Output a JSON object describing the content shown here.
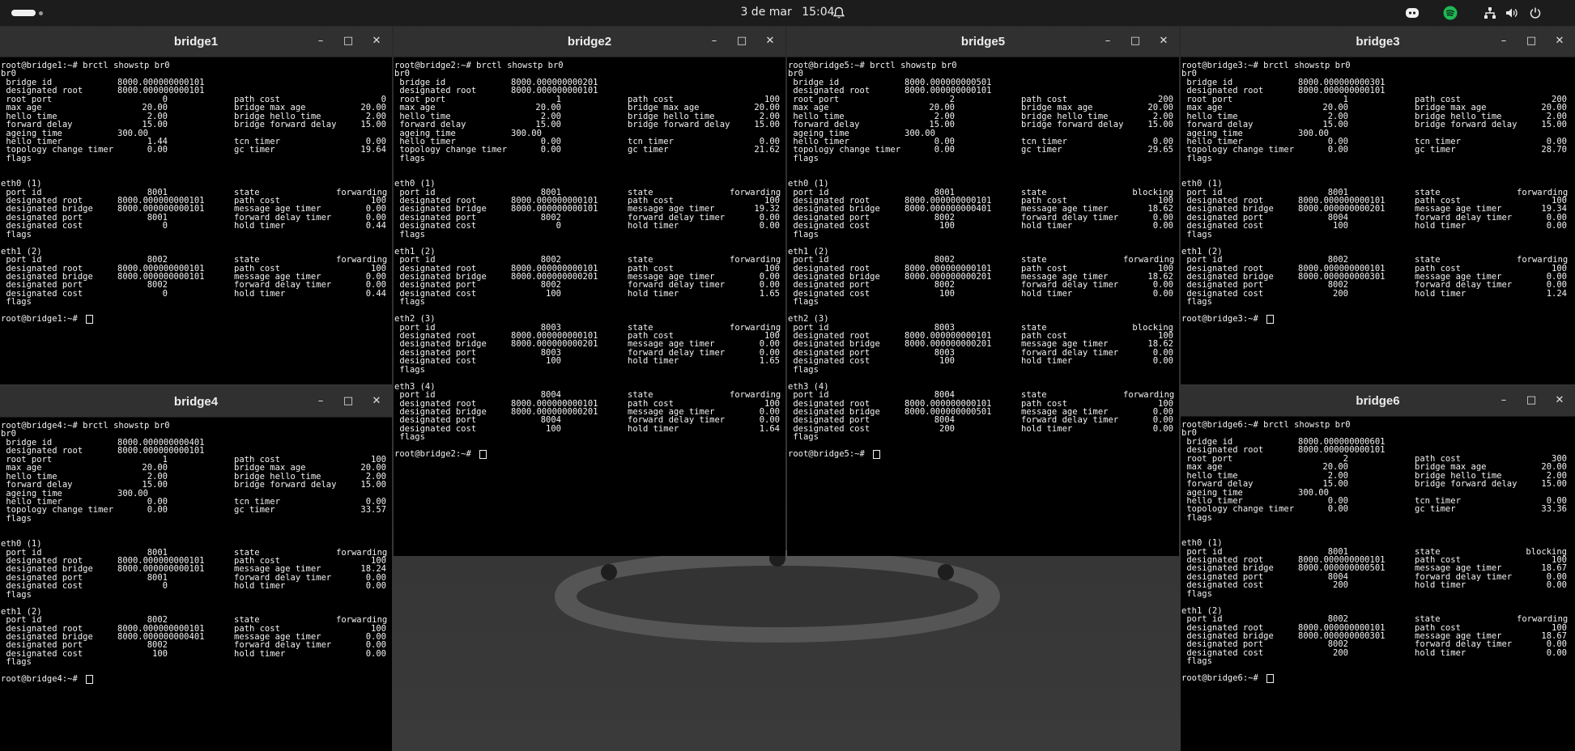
{
  "topbar": {
    "date": "3 de mar",
    "time": "15:04",
    "icons": [
      "activities-icon",
      "notification-bell-icon",
      "discord-icon",
      "spotify-icon",
      "network-icon",
      "volume-icon",
      "power-icon"
    ]
  },
  "windows": [
    {
      "id": "bridge1",
      "title": "bridge1",
      "lines": [
        [
          "root@bridge1:~# brctl showstp br0"
        ],
        [
          "br0"
        ],
        [
          " bridge id",
          "8000.000000000101"
        ],
        [
          " designated root",
          "8000.000000000101"
        ],
        [
          " root port",
          "0",
          "path cost",
          "0"
        ],
        [
          " max age",
          "20.00",
          "bridge max age",
          "20.00"
        ],
        [
          " hello time",
          "2.00",
          "bridge hello time",
          "2.00"
        ],
        [
          " forward delay",
          "15.00",
          "bridge forward delay",
          "15.00"
        ],
        [
          " ageing time",
          "300.00"
        ],
        [
          " hello timer",
          "1.44",
          "tcn timer",
          "0.00"
        ],
        [
          " topology change timer",
          "0.00",
          "gc timer",
          "19.64"
        ],
        [
          " flags"
        ],
        [
          ""
        ],
        [
          ""
        ],
        [
          "eth0 (1)"
        ],
        [
          " port id",
          "8001",
          "state",
          "forwarding"
        ],
        [
          " designated root",
          "8000.000000000101",
          "path cost",
          "100"
        ],
        [
          " designated bridge",
          "8000.000000000101",
          "message age timer",
          "0.00"
        ],
        [
          " designated port",
          "8001",
          "forward delay timer",
          "0.00"
        ],
        [
          " designated cost",
          "0",
          "hold timer",
          "0.44"
        ],
        [
          " flags"
        ],
        [
          ""
        ],
        [
          "eth1 (2)"
        ],
        [
          " port id",
          "8002",
          "state",
          "forwarding"
        ],
        [
          " designated root",
          "8000.000000000101",
          "path cost",
          "100"
        ],
        [
          " designated bridge",
          "8000.000000000101",
          "message age timer",
          "0.00"
        ],
        [
          " designated port",
          "8002",
          "forward delay timer",
          "0.00"
        ],
        [
          " designated cost",
          "0",
          "hold timer",
          "0.44"
        ],
        [
          " flags"
        ],
        [
          ""
        ],
        [
          "root@bridge1:~# "
        ]
      ]
    },
    {
      "id": "bridge2",
      "title": "bridge2",
      "lines": [
        [
          "root@bridge2:~# brctl showstp br0"
        ],
        [
          "br0"
        ],
        [
          " bridge id",
          "8000.000000000201"
        ],
        [
          " designated root",
          "8000.000000000101"
        ],
        [
          " root port",
          "1",
          "path cost",
          "100"
        ],
        [
          " max age",
          "20.00",
          "bridge max age",
          "20.00"
        ],
        [
          " hello time",
          "2.00",
          "bridge hello time",
          "2.00"
        ],
        [
          " forward delay",
          "15.00",
          "bridge forward delay",
          "15.00"
        ],
        [
          " ageing time",
          "300.00"
        ],
        [
          " hello timer",
          "0.00",
          "tcn timer",
          "0.00"
        ],
        [
          " topology change timer",
          "0.00",
          "gc timer",
          "21.62"
        ],
        [
          " flags"
        ],
        [
          ""
        ],
        [
          ""
        ],
        [
          "eth0 (1)"
        ],
        [
          " port id",
          "8001",
          "state",
          "forwarding"
        ],
        [
          " designated root",
          "8000.000000000101",
          "path cost",
          "100"
        ],
        [
          " designated bridge",
          "8000.000000000101",
          "message age timer",
          "19.32"
        ],
        [
          " designated port",
          "8002",
          "forward delay timer",
          "0.00"
        ],
        [
          " designated cost",
          "0",
          "hold timer",
          "0.00"
        ],
        [
          " flags"
        ],
        [
          ""
        ],
        [
          "eth1 (2)"
        ],
        [
          " port id",
          "8002",
          "state",
          "forwarding"
        ],
        [
          " designated root",
          "8000.000000000101",
          "path cost",
          "100"
        ],
        [
          " designated bridge",
          "8000.000000000201",
          "message age timer",
          "0.00"
        ],
        [
          " designated port",
          "8002",
          "forward delay timer",
          "0.00"
        ],
        [
          " designated cost",
          "100",
          "hold timer",
          "1.65"
        ],
        [
          " flags"
        ],
        [
          ""
        ],
        [
          "eth2 (3)"
        ],
        [
          " port id",
          "8003",
          "state",
          "forwarding"
        ],
        [
          " designated root",
          "8000.000000000101",
          "path cost",
          "100"
        ],
        [
          " designated bridge",
          "8000.000000000201",
          "message age timer",
          "0.00"
        ],
        [
          " designated port",
          "8003",
          "forward delay timer",
          "0.00"
        ],
        [
          " designated cost",
          "100",
          "hold timer",
          "1.65"
        ],
        [
          " flags"
        ],
        [
          ""
        ],
        [
          "eth3 (4)"
        ],
        [
          " port id",
          "8004",
          "state",
          "forwarding"
        ],
        [
          " designated root",
          "8000.000000000101",
          "path cost",
          "100"
        ],
        [
          " designated bridge",
          "8000.000000000201",
          "message age timer",
          "0.00"
        ],
        [
          " designated port",
          "8004",
          "forward delay timer",
          "0.00"
        ],
        [
          " designated cost",
          "100",
          "hold timer",
          "1.64"
        ],
        [
          " flags"
        ],
        [
          ""
        ],
        [
          "root@bridge2:~# "
        ]
      ]
    },
    {
      "id": "bridge5",
      "title": "bridge5",
      "lines": [
        [
          "root@bridge5:~# brctl showstp br0"
        ],
        [
          "br0"
        ],
        [
          " bridge id",
          "8000.000000000501"
        ],
        [
          " designated root",
          "8000.000000000101"
        ],
        [
          " root port",
          "2",
          "path cost",
          "200"
        ],
        [
          " max age",
          "20.00",
          "bridge max age",
          "20.00"
        ],
        [
          " hello time",
          "2.00",
          "bridge hello time",
          "2.00"
        ],
        [
          " forward delay",
          "15.00",
          "bridge forward delay",
          "15.00"
        ],
        [
          " ageing time",
          "300.00"
        ],
        [
          " hello timer",
          "0.00",
          "tcn timer",
          "0.00"
        ],
        [
          " topology change timer",
          "0.00",
          "gc timer",
          "29.65"
        ],
        [
          " flags"
        ],
        [
          ""
        ],
        [
          ""
        ],
        [
          "eth0 (1)"
        ],
        [
          " port id",
          "8001",
          "state",
          "blocking"
        ],
        [
          " designated root",
          "8000.000000000101",
          "path cost",
          "100"
        ],
        [
          " designated bridge",
          "8000.000000000401",
          "message age timer",
          "18.62"
        ],
        [
          " designated port",
          "8002",
          "forward delay timer",
          "0.00"
        ],
        [
          " designated cost",
          "100",
          "hold timer",
          "0.00"
        ],
        [
          " flags"
        ],
        [
          ""
        ],
        [
          "eth1 (2)"
        ],
        [
          " port id",
          "8002",
          "state",
          "forwarding"
        ],
        [
          " designated root",
          "8000.000000000101",
          "path cost",
          "100"
        ],
        [
          " designated bridge",
          "8000.000000000201",
          "message age timer",
          "18.62"
        ],
        [
          " designated port",
          "8002",
          "forward delay timer",
          "0.00"
        ],
        [
          " designated cost",
          "100",
          "hold timer",
          "0.00"
        ],
        [
          " flags"
        ],
        [
          ""
        ],
        [
          "eth2 (3)"
        ],
        [
          " port id",
          "8003",
          "state",
          "blocking"
        ],
        [
          " designated root",
          "8000.000000000101",
          "path cost",
          "100"
        ],
        [
          " designated bridge",
          "8000.000000000201",
          "message age timer",
          "18.62"
        ],
        [
          " designated port",
          "8003",
          "forward delay timer",
          "0.00"
        ],
        [
          " designated cost",
          "100",
          "hold timer",
          "0.00"
        ],
        [
          " flags"
        ],
        [
          ""
        ],
        [
          "eth3 (4)"
        ],
        [
          " port id",
          "8004",
          "state",
          "forwarding"
        ],
        [
          " designated root",
          "8000.000000000101",
          "path cost",
          "100"
        ],
        [
          " designated bridge",
          "8000.000000000501",
          "message age timer",
          "0.00"
        ],
        [
          " designated port",
          "8004",
          "forward delay timer",
          "0.00"
        ],
        [
          " designated cost",
          "200",
          "hold timer",
          "0.00"
        ],
        [
          " flags"
        ],
        [
          ""
        ],
        [
          "root@bridge5:~# "
        ]
      ]
    },
    {
      "id": "bridge3",
      "title": "bridge3",
      "lines": [
        [
          "root@bridge3:~# brctl showstp br0"
        ],
        [
          "br0"
        ],
        [
          " bridge id",
          "8000.000000000301"
        ],
        [
          " designated root",
          "8000.000000000101"
        ],
        [
          " root port",
          "1",
          "path cost",
          "200"
        ],
        [
          " max age",
          "20.00",
          "bridge max age",
          "20.00"
        ],
        [
          " hello time",
          "2.00",
          "bridge hello time",
          "2.00"
        ],
        [
          " forward delay",
          "15.00",
          "bridge forward delay",
          "15.00"
        ],
        [
          " ageing time",
          "300.00"
        ],
        [
          " hello timer",
          "0.00",
          "tcn timer",
          "0.00"
        ],
        [
          " topology change timer",
          "0.00",
          "gc timer",
          "28.70"
        ],
        [
          " flags"
        ],
        [
          ""
        ],
        [
          ""
        ],
        [
          "eth0 (1)"
        ],
        [
          " port id",
          "8001",
          "state",
          "forwarding"
        ],
        [
          " designated root",
          "8000.000000000101",
          "path cost",
          "100"
        ],
        [
          " designated bridge",
          "8000.000000000201",
          "message age timer",
          "19.34"
        ],
        [
          " designated port",
          "8004",
          "forward delay timer",
          "0.00"
        ],
        [
          " designated cost",
          "100",
          "hold timer",
          "0.00"
        ],
        [
          " flags"
        ],
        [
          ""
        ],
        [
          "eth1 (2)"
        ],
        [
          " port id",
          "8002",
          "state",
          "forwarding"
        ],
        [
          " designated root",
          "8000.000000000101",
          "path cost",
          "100"
        ],
        [
          " designated bridge",
          "8000.000000000301",
          "message age timer",
          "0.00"
        ],
        [
          " designated port",
          "8002",
          "forward delay timer",
          "0.00"
        ],
        [
          " designated cost",
          "200",
          "hold timer",
          "1.24"
        ],
        [
          " flags"
        ],
        [
          ""
        ],
        [
          "root@bridge3:~# "
        ]
      ]
    },
    {
      "id": "bridge4",
      "title": "bridge4",
      "lines": [
        [
          "root@bridge4:~# brctl showstp br0"
        ],
        [
          "br0"
        ],
        [
          " bridge id",
          "8000.000000000401"
        ],
        [
          " designated root",
          "8000.000000000101"
        ],
        [
          " root port",
          "1",
          "path cost",
          "100"
        ],
        [
          " max age",
          "20.00",
          "bridge max age",
          "20.00"
        ],
        [
          " hello time",
          "2.00",
          "bridge hello time",
          "2.00"
        ],
        [
          " forward delay",
          "15.00",
          "bridge forward delay",
          "15.00"
        ],
        [
          " ageing time",
          "300.00"
        ],
        [
          " hello timer",
          "0.00",
          "tcn timer",
          "0.00"
        ],
        [
          " topology change timer",
          "0.00",
          "gc timer",
          "33.57"
        ],
        [
          " flags"
        ],
        [
          ""
        ],
        [
          ""
        ],
        [
          "eth0 (1)"
        ],
        [
          " port id",
          "8001",
          "state",
          "forwarding"
        ],
        [
          " designated root",
          "8000.000000000101",
          "path cost",
          "100"
        ],
        [
          " designated bridge",
          "8000.000000000101",
          "message age timer",
          "18.24"
        ],
        [
          " designated port",
          "8001",
          "forward delay timer",
          "0.00"
        ],
        [
          " designated cost",
          "0",
          "hold timer",
          "0.00"
        ],
        [
          " flags"
        ],
        [
          ""
        ],
        [
          "eth1 (2)"
        ],
        [
          " port id",
          "8002",
          "state",
          "forwarding"
        ],
        [
          " designated root",
          "8000.000000000101",
          "path cost",
          "100"
        ],
        [
          " designated bridge",
          "8000.000000000401",
          "message age timer",
          "0.00"
        ],
        [
          " designated port",
          "8002",
          "forward delay timer",
          "0.00"
        ],
        [
          " designated cost",
          "100",
          "hold timer",
          "0.00"
        ],
        [
          " flags"
        ],
        [
          ""
        ],
        [
          "root@bridge4:~# "
        ]
      ]
    },
    {
      "id": "bridge6",
      "title": "bridge6",
      "lines": [
        [
          "root@bridge6:~# brctl showstp br0"
        ],
        [
          "br0"
        ],
        [
          " bridge id",
          "8000.000000000601"
        ],
        [
          " designated root",
          "8000.000000000101"
        ],
        [
          " root port",
          "2",
          "path cost",
          "300"
        ],
        [
          " max age",
          "20.00",
          "bridge max age",
          "20.00"
        ],
        [
          " hello time",
          "2.00",
          "bridge hello time",
          "2.00"
        ],
        [
          " forward delay",
          "15.00",
          "bridge forward delay",
          "15.00"
        ],
        [
          " ageing time",
          "300.00"
        ],
        [
          " hello timer",
          "0.00",
          "tcn timer",
          "0.00"
        ],
        [
          " topology change timer",
          "0.00",
          "gc timer",
          "33.36"
        ],
        [
          " flags"
        ],
        [
          ""
        ],
        [
          ""
        ],
        [
          "eth0 (1)"
        ],
        [
          " port id",
          "8001",
          "state",
          "blocking"
        ],
        [
          " designated root",
          "8000.000000000101",
          "path cost",
          "100"
        ],
        [
          " designated bridge",
          "8000.000000000501",
          "message age timer",
          "18.67"
        ],
        [
          " designated port",
          "8004",
          "forward delay timer",
          "0.00"
        ],
        [
          " designated cost",
          "200",
          "hold timer",
          "0.00"
        ],
        [
          " flags"
        ],
        [
          ""
        ],
        [
          "eth1 (2)"
        ],
        [
          " port id",
          "8002",
          "state",
          "forwarding"
        ],
        [
          " designated root",
          "8000.000000000101",
          "path cost",
          "100"
        ],
        [
          " designated bridge",
          "8000.000000000301",
          "message age timer",
          "18.67"
        ],
        [
          " designated port",
          "8002",
          "forward delay timer",
          "0.00"
        ],
        [
          " designated cost",
          "200",
          "hold timer",
          "0.00"
        ],
        [
          " flags"
        ],
        [
          ""
        ],
        [
          "root@bridge6:~# "
        ]
      ]
    }
  ]
}
